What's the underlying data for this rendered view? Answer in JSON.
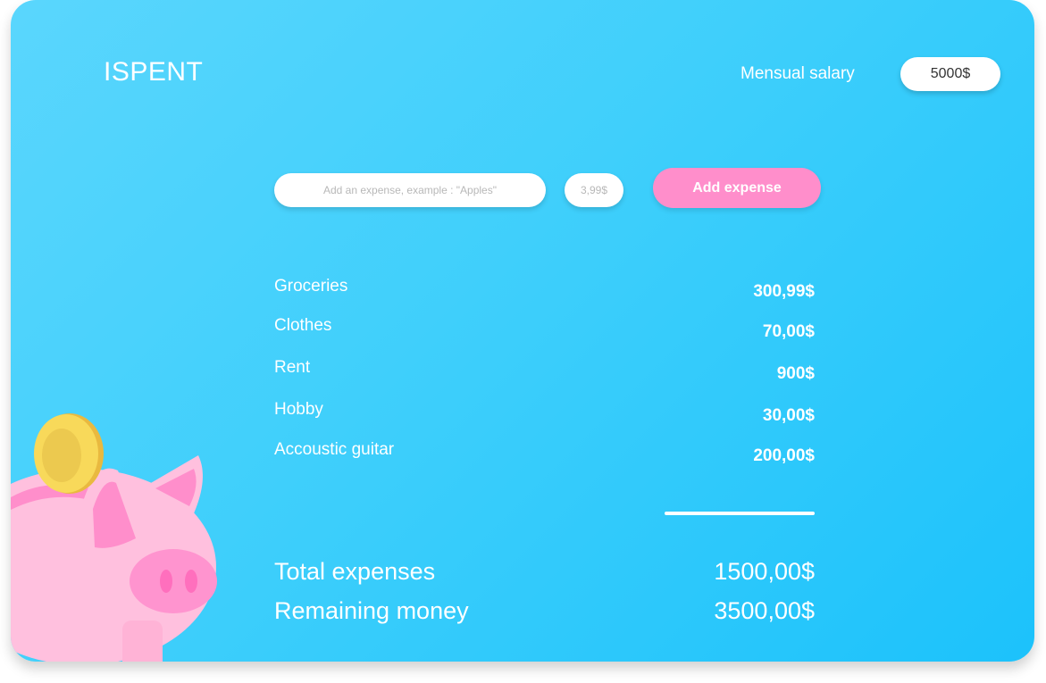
{
  "app": {
    "title": "ISPENT"
  },
  "header": {
    "salary_label": "Mensual salary",
    "salary_value": "5000$"
  },
  "form": {
    "expense_placeholder": "Add an expense, example : \"Apples\"",
    "amount_placeholder": "3,99$",
    "add_button_label": "Add expense"
  },
  "expenses": [
    {
      "name": "Groceries",
      "amount": "300,99$"
    },
    {
      "name": "Clothes",
      "amount": "70,00$"
    },
    {
      "name": "Rent",
      "amount": "900$"
    },
    {
      "name": "Hobby",
      "amount": "30,00$"
    },
    {
      "name": "Accoustic guitar",
      "amount": "200,00$"
    }
  ],
  "totals": {
    "total_label": "Total expenses",
    "total_value": "1500,00$",
    "remaining_label": "Remaining money",
    "remaining_value": "3500,00$"
  },
  "illustration": {
    "icon": "piggy-bank-icon",
    "coin_icon": "coin-icon"
  },
  "colors": {
    "background_start": "#5ad6fd",
    "background_end": "#1cc2fb",
    "accent_button": "#ff8ecb",
    "pig_pink": "#ffc0de",
    "coin_yellow": "#f8d95a"
  }
}
